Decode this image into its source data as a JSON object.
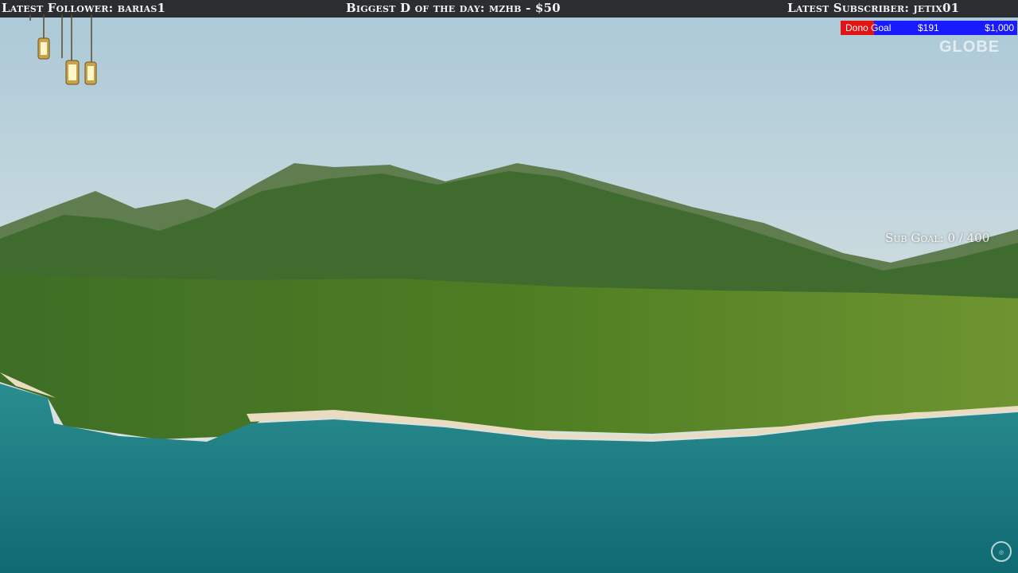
{
  "stream_overlay": {
    "latest_follower": "Latest Follower: barias1",
    "biggest_donation": "Biggest D of the day: mzhb - $50",
    "latest_subscriber": "Latest Subscriber: jetix01"
  },
  "dono_goal": {
    "label": "Dono Goal",
    "current": "$191",
    "target": "$1,000",
    "progress": 0.191,
    "fill_color": "#e31313",
    "track_color": "#1a1aff"
  },
  "sub_goal": {
    "text": "Sub Goal: 0 / 400"
  },
  "watermark": {
    "brand": "GLOBE"
  },
  "icons": {
    "lanterns": "hanging-lanterns-icon",
    "corner_logo": "globe-logo-icon"
  },
  "colors": {
    "topbar_bg": "#2b2d31",
    "sea": "#1e7f84",
    "sky": "#c6d7dd"
  }
}
